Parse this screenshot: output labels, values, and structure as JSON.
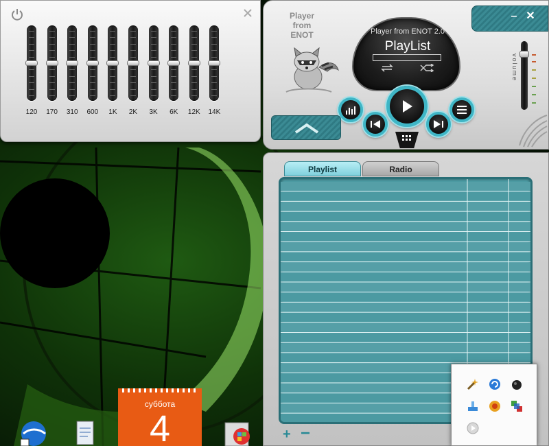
{
  "equalizer": {
    "bands": [
      {
        "label": "120",
        "level": 0.5
      },
      {
        "label": "170",
        "level": 0.5
      },
      {
        "label": "310",
        "level": 0.5
      },
      {
        "label": "600",
        "level": 0.5
      },
      {
        "label": "1K",
        "level": 0.5
      },
      {
        "label": "2K",
        "level": 0.5
      },
      {
        "label": "3K",
        "level": 0.5
      },
      {
        "label": "6K",
        "level": 0.5
      },
      {
        "label": "12K",
        "level": 0.5
      },
      {
        "label": "14K",
        "level": 0.5
      }
    ],
    "icons": {
      "power": "power-icon",
      "close": "close-icon"
    }
  },
  "player": {
    "brand": "Player from ENOT",
    "brand_lines": [
      "Player",
      "from",
      "ENOT"
    ],
    "display_title": "Player from ENOT 2.0",
    "display_main": "PlayList",
    "window_buttons": {
      "minimize": "–",
      "close": "✕"
    },
    "volume_label": "volume",
    "volume_level": 0.85,
    "accent": "#3fb6c6"
  },
  "playlist": {
    "tabs": [
      {
        "label": "Playlist",
        "active": true
      },
      {
        "label": "Radio",
        "active": false
      }
    ],
    "rows": 24,
    "add_label": "+",
    "remove_label": "−",
    "list_color": "#4f9fa7"
  },
  "calendar": {
    "weekday": "суббота",
    "date": "4"
  },
  "tray": {
    "icons": [
      "wand-icon",
      "refresh-icon",
      "bomb-icon",
      "network-icon",
      "shield-icon",
      "windows-icon",
      "play-icon"
    ]
  }
}
